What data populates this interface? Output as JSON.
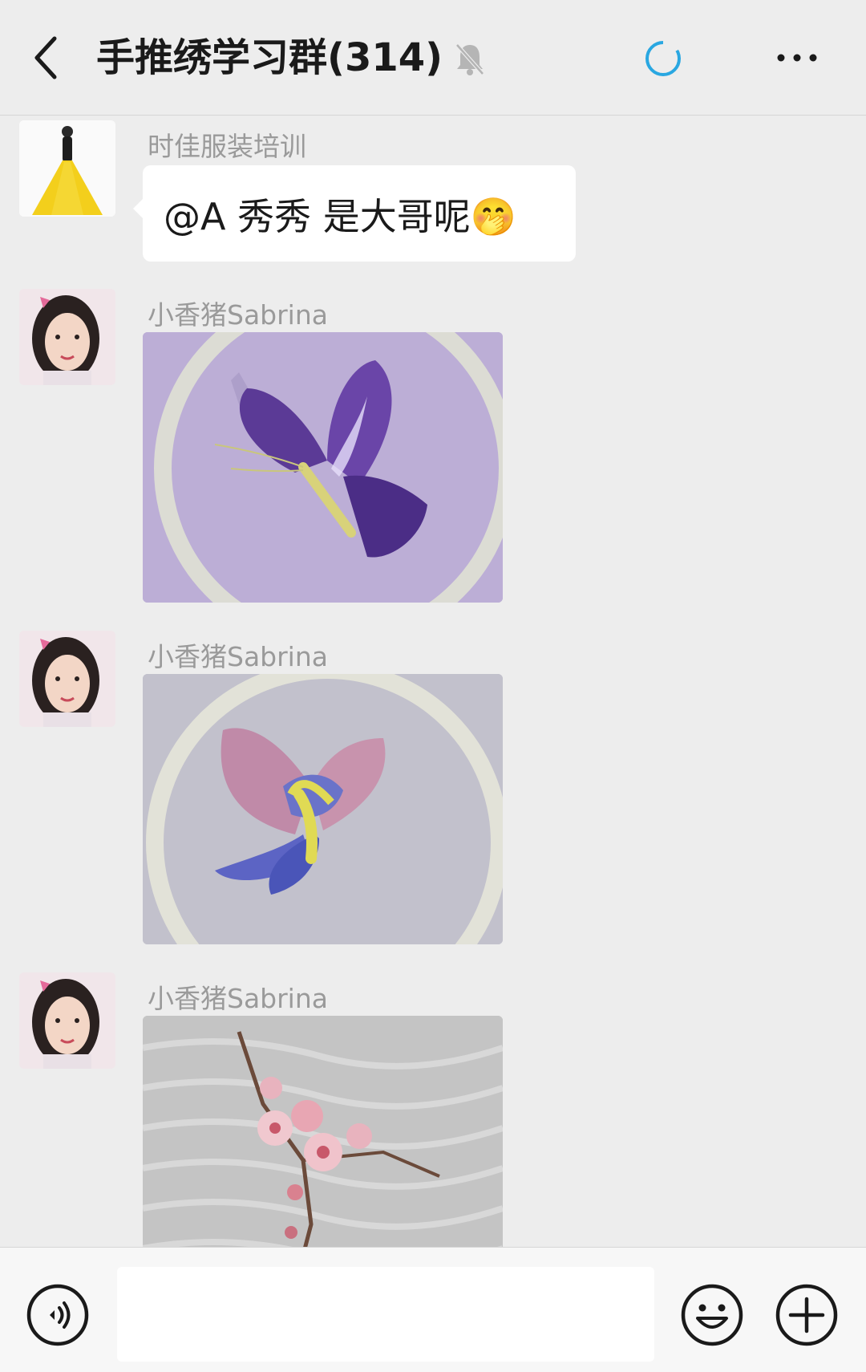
{
  "header": {
    "title": "手推绣学习群(314)",
    "back_icon": "chevron-left-icon",
    "mute_icon": "bell-muted-icon",
    "loading_icon": "loading-spinner-icon",
    "more_icon": "more-horizontal-icon"
  },
  "messages": [
    {
      "sender": "时佳服装培训",
      "type": "text",
      "text": "@A 秀秀  是大哥呢",
      "emoji": "🤭"
    },
    {
      "sender": "小香猪Sabrina",
      "type": "image",
      "image": "purple butterfly embroidery on hoop"
    },
    {
      "sender": "小香猪Sabrina",
      "type": "image",
      "image": "pink and blue butterfly embroidery"
    },
    {
      "sender": "小香猪Sabrina",
      "type": "image",
      "image": "plum blossom branch embroidery"
    }
  ],
  "inputbar": {
    "voice_icon": "voice-icon",
    "input_value": "",
    "emoji_icon": "smiley-icon",
    "plus_icon": "plus-circle-icon"
  },
  "colors": {
    "background": "#ededed",
    "bubble": "#ffffff",
    "spinner": "#29a7e1"
  }
}
